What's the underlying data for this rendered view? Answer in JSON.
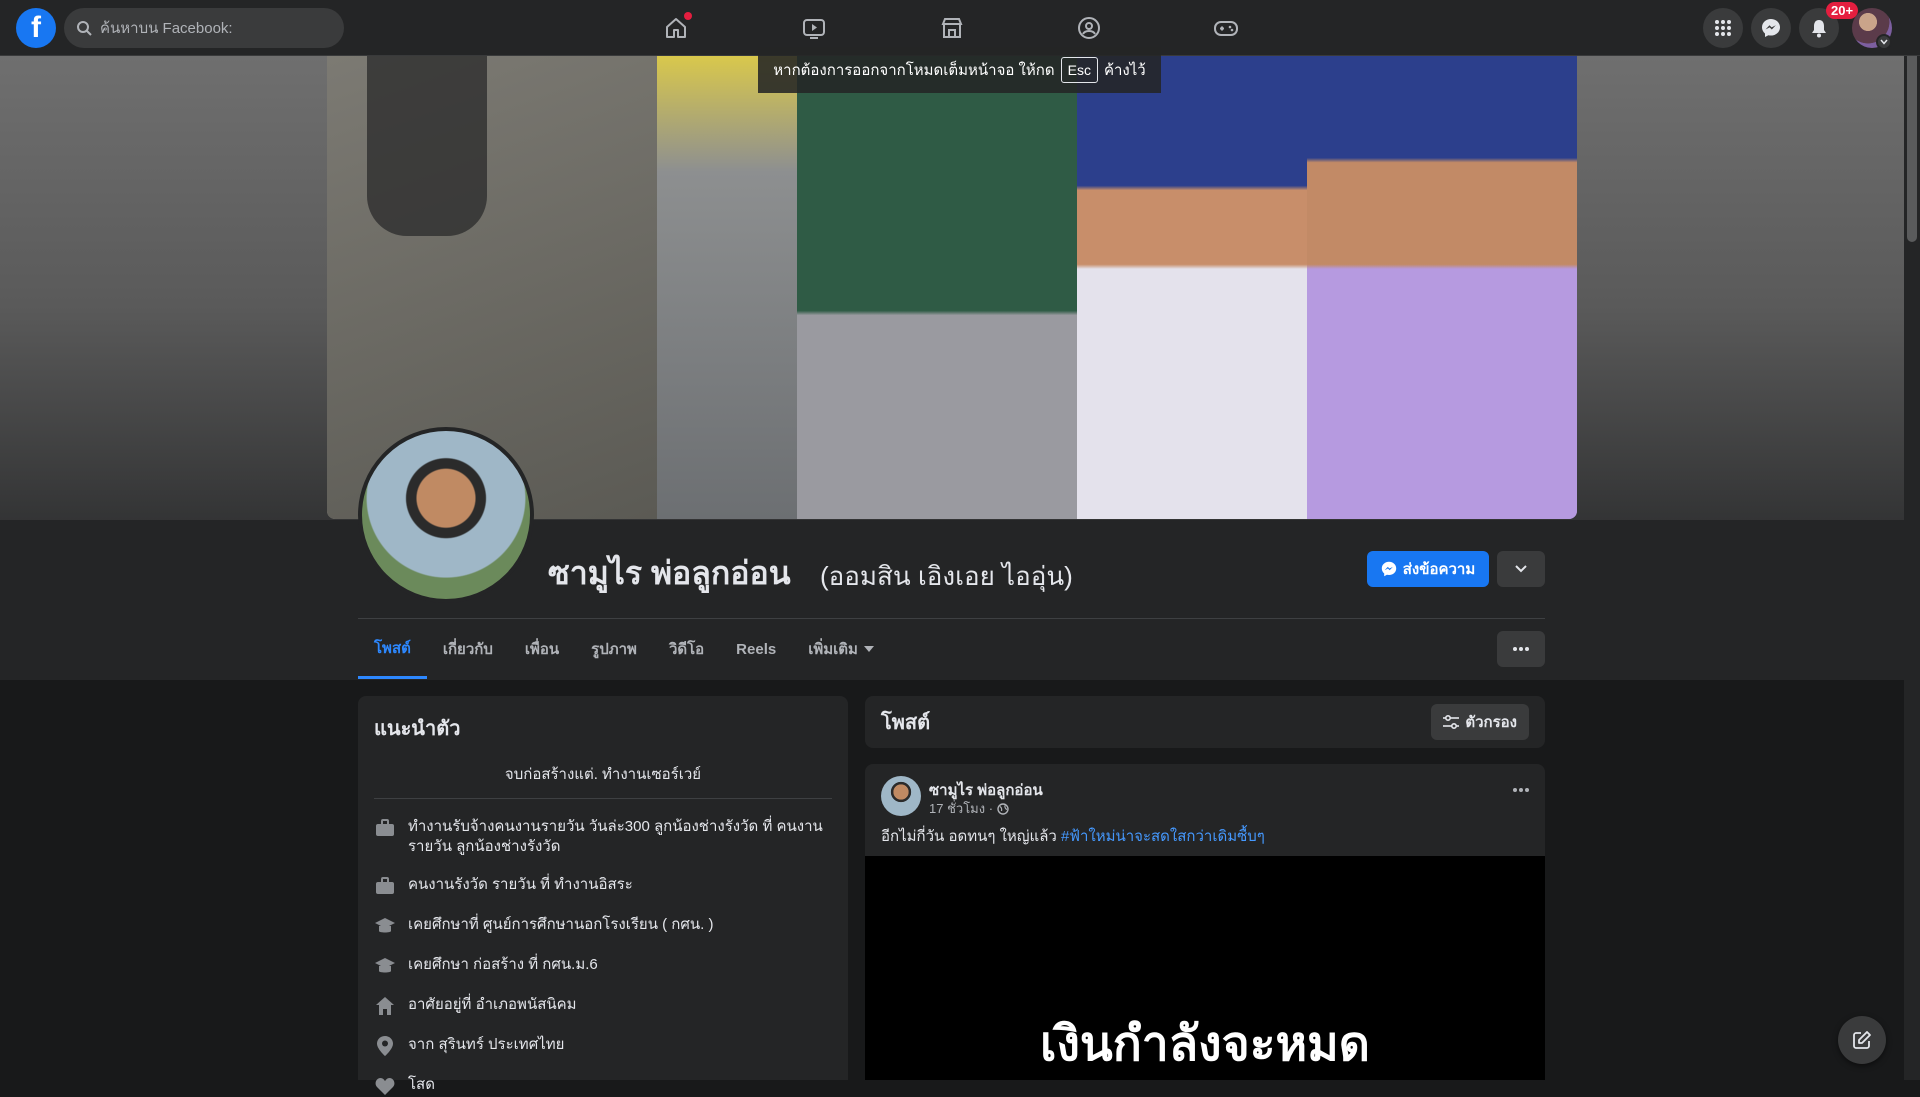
{
  "topbar": {
    "logo_letter": "f",
    "search_placeholder": "ค้นหาบน Facebook:",
    "notifications_badge": "20+"
  },
  "fullscreen_notice": {
    "text_before": "หากต้องการออกจากโหมดเต็มหน้าจอ ให้กด",
    "key": "Esc",
    "text_after": "ค้างไว้"
  },
  "profile": {
    "name": "ซามูไร พ่อลูกอ่อน",
    "alt_name": "(ออมสิน เอิงเอย ไออุ่น)",
    "message_button": "ส่งข้อความ"
  },
  "tabs": [
    {
      "label": "โพสต์"
    },
    {
      "label": "เกี่ยวกับ"
    },
    {
      "label": "เพื่อน"
    },
    {
      "label": "รูปภาพ"
    },
    {
      "label": "วิดีโอ"
    },
    {
      "label": "Reels"
    },
    {
      "label": "เพิ่มเติม"
    }
  ],
  "intro": {
    "title": "แนะนำตัว",
    "bio": "จบก่อสร้างแต่. ทำงานเซอร์เวย์",
    "items": [
      {
        "icon": "briefcase-icon",
        "text": "ทำงานรับจ้างคนงานรายวัน วันล่ะ300 ลูกน้องช่างรังวัด ที่ คนงานรายวัน ลูกน้องช่างรังวัด"
      },
      {
        "icon": "briefcase-icon",
        "text": "คนงานรังวัด รายวัน ที่ ทำงานอิสระ"
      },
      {
        "icon": "graduation-cap-icon",
        "text": "เคยศึกษาที่ ศูนย์การศึกษานอกโรงเรียน ( กศน. )"
      },
      {
        "icon": "graduation-cap-icon",
        "text": "เคยศึกษา ก่อสร้าง ที่ กศน.ม.6"
      },
      {
        "icon": "home-icon",
        "text": "อาศัยอยู่ที่ อำเภอพนัสนิคม"
      },
      {
        "icon": "location-pin-icon",
        "text": "จาก สุรินทร์ ประเทศไทย"
      },
      {
        "icon": "heart-icon",
        "text": "โสด"
      }
    ]
  },
  "posts": {
    "title": "โพสต์",
    "filter_button": "ตัวกรอง",
    "post": {
      "author": "ซามูไร พ่อลูกอ่อน",
      "time": "17 ชั่วโมง ·",
      "text": "อีกไม่กี่วัน อดทนๆ ใหญ่แล้ว",
      "hashtag": "#ฟ้าใหม่น่าจะสดใสกว่าเดิมซื้บๆ",
      "image_text": "เงินกำลังจะหมด"
    }
  },
  "colors": {
    "accent": "#1877f2",
    "link": "#2d88ff",
    "background": "#18191a",
    "card": "#242526"
  }
}
